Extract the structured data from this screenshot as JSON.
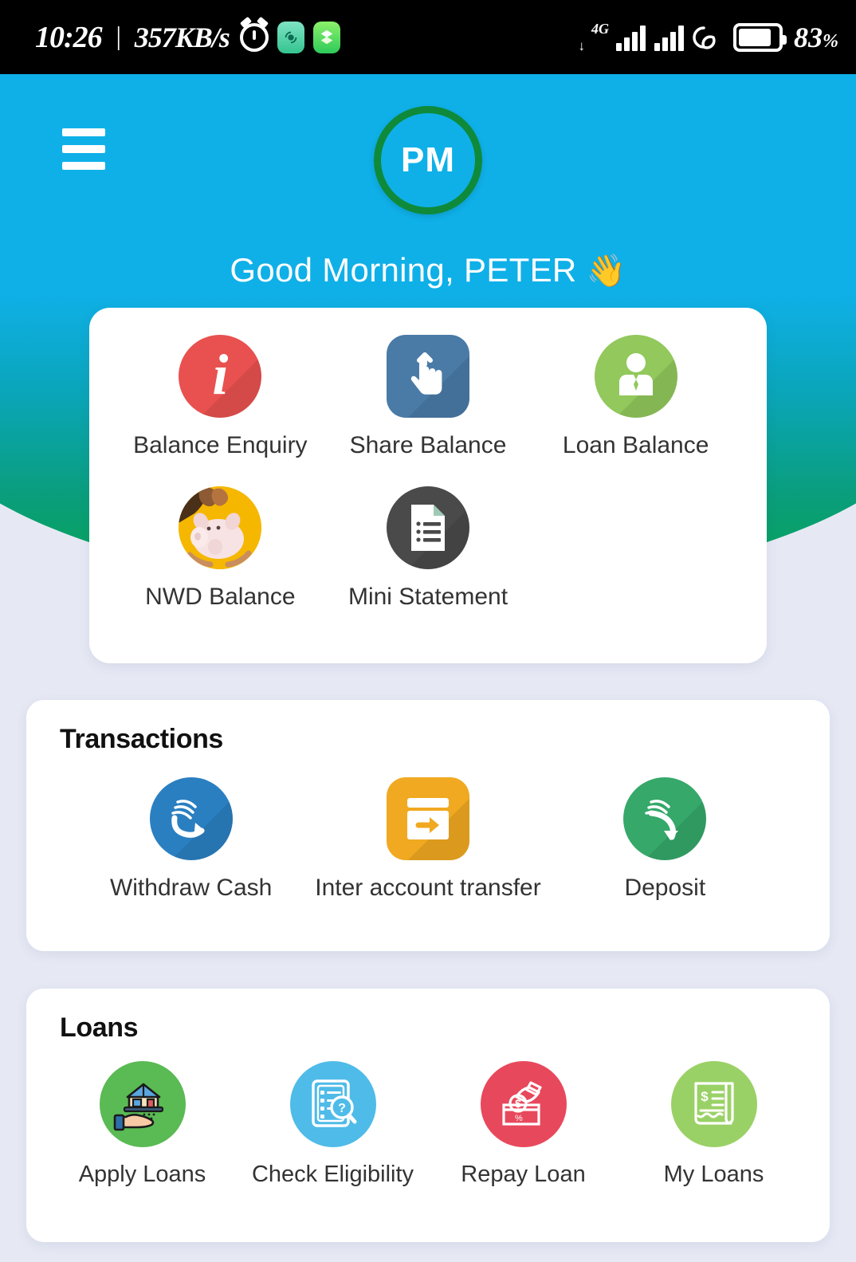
{
  "status_bar": {
    "time": "10:26",
    "separator": "|",
    "network_speed": "357KB/s",
    "alarm_icon": "alarm-icon",
    "app_icon_1": "app-icon-teal",
    "app_icon_2": "app-icon-green",
    "network_type": "4G",
    "battery_percent": "83",
    "battery_percent_symbol": "%"
  },
  "header": {
    "menu_icon": "hamburger-menu-icon",
    "avatar_initials": "PM",
    "avatar_ring_color": "#0e8a3a",
    "greeting": "Good Morning, PETER",
    "greeting_emoji": "👋",
    "background_top_color": "#0fb0e8",
    "background_bottom_color": "#06a44f"
  },
  "quick_actions": {
    "tiles": [
      {
        "label": "Balance Enquiry",
        "icon": "info-icon",
        "color": "#e8514f"
      },
      {
        "label": "Share Balance",
        "icon": "tap-hand-icon",
        "color": "#4a7ba7"
      },
      {
        "label": "Loan Balance",
        "icon": "person-tie-icon",
        "color": "#92c85c"
      },
      {
        "label": "NWD Balance",
        "icon": "piggy-bank-icon",
        "color": "#f5b700"
      },
      {
        "label": "Mini Statement",
        "icon": "document-list-icon",
        "color": "#4a4a4a"
      }
    ]
  },
  "transactions": {
    "title": "Transactions",
    "tiles": [
      {
        "label": "Withdraw Cash",
        "icon": "cash-withdraw-icon",
        "color": "#2a7fc1"
      },
      {
        "label": "Inter account transfer",
        "icon": "card-transfer-icon",
        "color": "#f0a920"
      },
      {
        "label": "Deposit",
        "icon": "cash-deposit-icon",
        "color": "#35a86a"
      }
    ]
  },
  "loans": {
    "title": "Loans",
    "tiles": [
      {
        "label": "Apply Loans",
        "icon": "house-on-hand-icon",
        "color": "#5aba54"
      },
      {
        "label": "Check Eligibility",
        "icon": "document-search-icon",
        "color": "#4fbbe8"
      },
      {
        "label": "Repay Loan",
        "icon": "coin-drop-icon",
        "color": "#e8485c"
      },
      {
        "label": "My Loans",
        "icon": "receipt-scroll-icon",
        "color": "#9ad166"
      }
    ]
  },
  "page_background_color": "#e6e9f4"
}
